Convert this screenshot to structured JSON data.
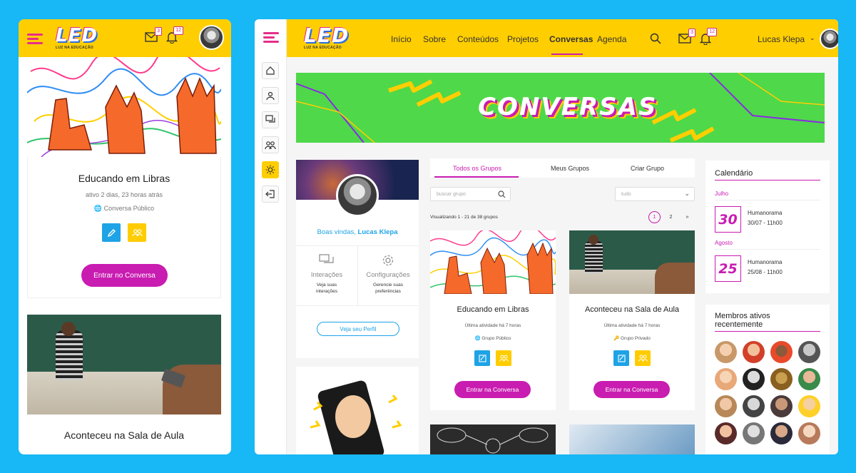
{
  "brand": {
    "logo": "LED",
    "tagline": "LUZ NA EDUCAÇÃO"
  },
  "notifications": {
    "messages": "3",
    "alerts": "12"
  },
  "mobile": {
    "card1": {
      "title": "Educando em Libras",
      "activity": "ativo 2 dias, 23 horas atrás",
      "privacy": "Conversa Público",
      "cta": "Entrar no Conversa"
    },
    "card2": {
      "title": "Aconteceu na Sala de Aula"
    }
  },
  "desktop": {
    "nav": [
      "Início",
      "Sobre",
      "Conteúdos",
      "Projetos",
      "Conversas",
      "Agenda"
    ],
    "active_nav": "Conversas",
    "user": "Lucas Klepa",
    "banner_title": "CONVERSAS",
    "profile": {
      "welcome_prefix": "Boas vindas,",
      "welcome_name": "Lucas Klepa",
      "interactions_title": "Interações",
      "interactions_sub": "Veja suas interações",
      "settings_title": "Configurações",
      "settings_sub": "Gerencie suas preferências",
      "profile_button": "Veja seu Perfil"
    },
    "tabs": [
      "Todos os Grupos",
      "Meus Grupos",
      "Criar Grupo"
    ],
    "search_placeholder": "buscar grupo",
    "filter_value": "tudo",
    "results_text": "Visualizando 1 - 21 de 38 grupos",
    "pagination": [
      "1",
      "2",
      "»"
    ],
    "groups": [
      {
        "title": "Educando em Libras",
        "activity": "Última atividade há 7 horas",
        "privacy": "Grupo Público",
        "cta": "Entrar na Conversa"
      },
      {
        "title": "Aconteceu na Sala de Aula",
        "activity": "Última atividade há 7 horas",
        "privacy": "Grupo Privado",
        "cta": "Entrar na Conversa"
      }
    ],
    "calendar": {
      "title": "Calendário",
      "events": [
        {
          "month": "Julho",
          "day": "30",
          "name": "Humanorama",
          "datetime": "30/07 - 11h00"
        },
        {
          "month": "Agosto",
          "day": "25",
          "name": "Humanorama",
          "datetime": "25/08 - 11h00"
        }
      ]
    },
    "members_title": "Membros ativos recentemente"
  },
  "colors": {
    "page_bg": "#18b7f5",
    "header_yellow": "#ffce00",
    "accent_magenta": "#c91cb1",
    "banner_green": "#4fd84a",
    "button_blue": "#1ea3e6"
  }
}
